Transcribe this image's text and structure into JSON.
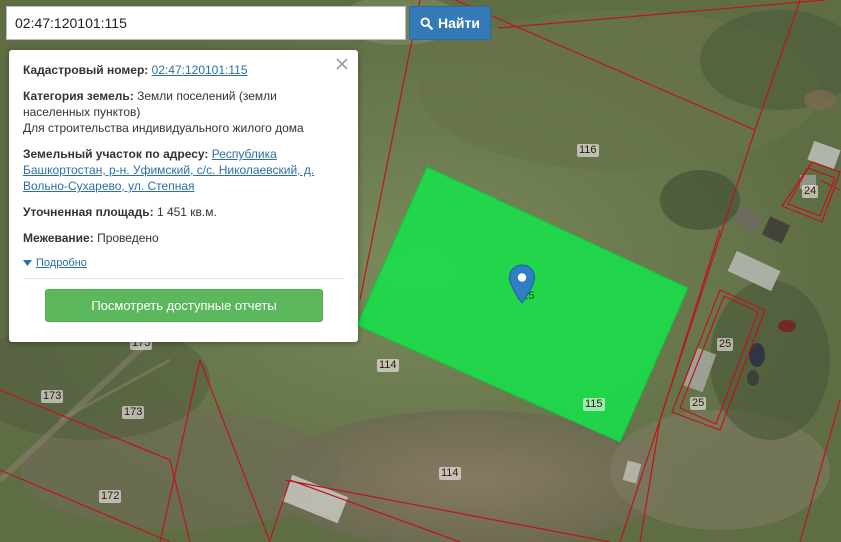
{
  "search": {
    "value": "02:47:120101:115",
    "button_label": "Найти"
  },
  "info": {
    "cadastral_label": "Кадастровый номер:",
    "cadastral_value": "02:47:120101:115",
    "category_label": "Категория земель:",
    "category_value": "Земли поселений (земли населенных пунктов)",
    "category_usage": "Для строительства индивидуального жилого дома",
    "address_label": "Земельный участок по адресу:",
    "address_value": "Республика Башкортостан, р-н. Уфимский, с/с. Николаевский, д. Вольно-Сухарево, ул. Степная",
    "area_label": "Уточненная площадь:",
    "area_value": "1 451 кв.м.",
    "survey_label": "Межевание:",
    "survey_value": "Проведено",
    "details_label": "Подробно",
    "reports_button": "Посмотреть доступные отчеты"
  },
  "map": {
    "parcel_labels": [
      "116",
      "24",
      "25",
      "25",
      "114",
      "115",
      "173",
      "173",
      "114",
      "172",
      "175",
      "115"
    ],
    "selected_fill": "#17e04a",
    "boundary_color": "#c0141c",
    "marker_color": "#2f7fc7"
  }
}
